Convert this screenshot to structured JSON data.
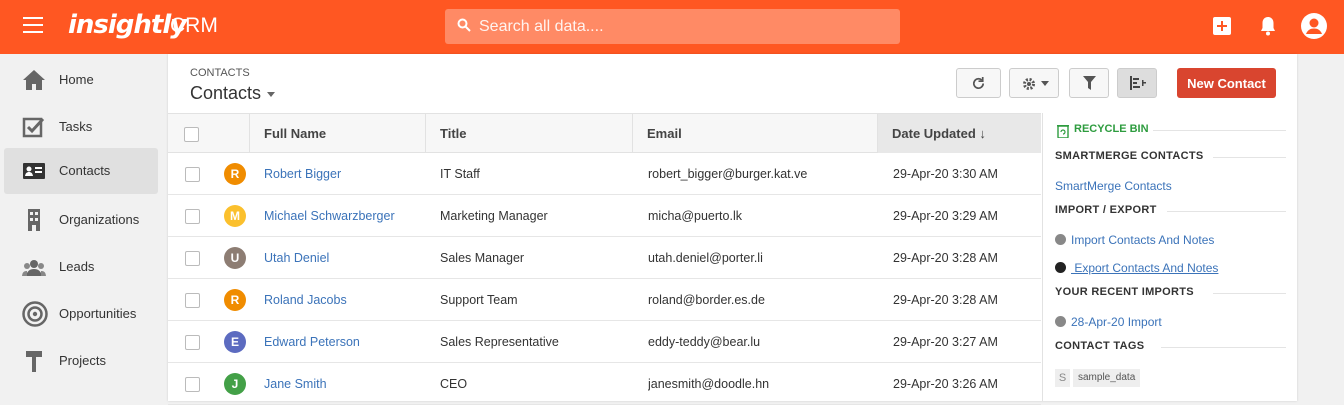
{
  "header": {
    "logo_text": "insightly",
    "app_name": "CRM",
    "search_placeholder": "Search all data...."
  },
  "sidebar": {
    "items": [
      {
        "label": "Home",
        "icon": "home-icon"
      },
      {
        "label": "Tasks",
        "icon": "tasks-icon"
      },
      {
        "label": "Contacts",
        "icon": "contacts-icon",
        "active": true
      },
      {
        "label": "Organizations",
        "icon": "organizations-icon"
      },
      {
        "label": "Leads",
        "icon": "leads-icon"
      },
      {
        "label": "Opportunities",
        "icon": "opportunities-icon"
      },
      {
        "label": "Projects",
        "icon": "projects-icon"
      }
    ]
  },
  "main": {
    "breadcrumb": "CONTACTS",
    "view_title": "Contacts",
    "new_contact_label": "New Contact"
  },
  "table": {
    "columns": [
      "Full Name",
      "Title",
      "Email",
      "Date Updated ↓"
    ],
    "rows": [
      {
        "initial": "R",
        "color": "#f08c00",
        "name": "Robert Bigger",
        "title": "IT Staff",
        "email": "robert_bigger@burger.kat.ve",
        "date": "29-Apr-20 3:30 AM"
      },
      {
        "initial": "M",
        "color": "#fbc02d",
        "name": "Michael Schwarzberger",
        "title": "Marketing Manager",
        "email": "micha@puerto.lk",
        "date": "29-Apr-20 3:29 AM"
      },
      {
        "initial": "U",
        "color": "#8d7d73",
        "name": "Utah Deniel",
        "title": "Sales Manager",
        "email": "utah.deniel@porter.li",
        "date": "29-Apr-20 3:28 AM"
      },
      {
        "initial": "R",
        "color": "#f08c00",
        "name": "Roland Jacobs",
        "title": "Support Team",
        "email": "roland@border.es.de",
        "date": "29-Apr-20 3:28 AM"
      },
      {
        "initial": "E",
        "color": "#5c6bc0",
        "name": "Edward Peterson",
        "title": "Sales Representative",
        "email": "eddy-teddy@bear.lu",
        "date": "29-Apr-20 3:27 AM"
      },
      {
        "initial": "J",
        "color": "#43a047",
        "name": "Jane Smith",
        "title": "CEO",
        "email": "janesmith@doodle.hn",
        "date": "29-Apr-20 3:26 AM"
      }
    ]
  },
  "right_panel": {
    "recycle_bin": "RECYCLE BIN",
    "smartmerge_heading": "SMARTMERGE CONTACTS",
    "smartmerge_link": "SmartMerge Contacts",
    "import_export_heading": "IMPORT / EXPORT",
    "import_link": "Import Contacts And Notes",
    "export_link": " Export Contacts And Notes",
    "recent_imports_heading": "YOUR RECENT IMPORTS",
    "recent_import_link": "28-Apr-20 Import",
    "tags_heading": "CONTACT TAGS",
    "tag_prefix": "S",
    "tag_label": "sample_data"
  },
  "colors": {
    "brand": "#ff5722",
    "new_button": "#d9452f",
    "link": "#3b73b9",
    "recycle": "#2e9c3f"
  }
}
